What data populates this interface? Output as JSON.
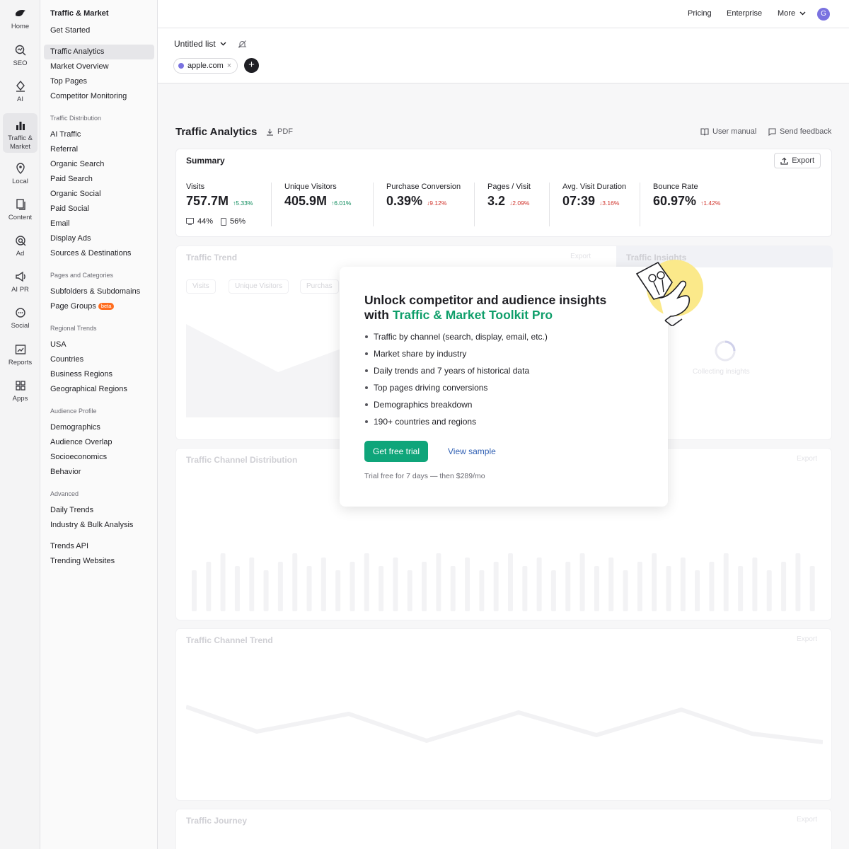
{
  "rail": [
    {
      "label": "Home",
      "icon": "home-icon"
    },
    {
      "label": "SEO",
      "icon": "seo-icon"
    },
    {
      "label": "AI",
      "icon": "ai-icon"
    },
    {
      "label": "Traffic &",
      "label2": "Market",
      "icon": "bar-chart-icon",
      "active": true
    },
    {
      "label": "Local",
      "icon": "map-pin-icon"
    },
    {
      "label": "Content",
      "icon": "content-icon"
    },
    {
      "label": "Ad",
      "icon": "ad-icon"
    },
    {
      "label": "AI PR",
      "icon": "megaphone-icon"
    },
    {
      "label": "Social",
      "icon": "chat-icon"
    },
    {
      "label": "Reports",
      "icon": "reports-icon"
    },
    {
      "label": "Apps",
      "icon": "grid-icon"
    }
  ],
  "nav": {
    "title": "Traffic & Market",
    "get_started": "Get Started",
    "top_items": [
      "Traffic Analytics",
      "Market Overview",
      "Top Pages",
      "Competitor Monitoring"
    ],
    "sections": [
      {
        "title": "Traffic Distribution",
        "items": [
          "AI Traffic",
          "Referral",
          "Organic Search",
          "Paid Search",
          "Organic Social",
          "Paid Social",
          "Email",
          "Display Ads",
          "Sources & Destinations"
        ]
      },
      {
        "title": "Pages and Categories",
        "items": [
          "Subfolders & Subdomains",
          "Page Groups"
        ]
      },
      {
        "title": "Regional Trends",
        "items": [
          "USA",
          "Countries",
          "Business Regions",
          "Geographical Regions"
        ]
      },
      {
        "title": "Audience Profile",
        "items": [
          "Demographics",
          "Audience Overlap",
          "Socioeconomics",
          "Behavior"
        ]
      },
      {
        "title": "Advanced",
        "items": [
          "Daily Trends",
          "Industry & Bulk Analysis"
        ]
      }
    ],
    "beta_badge": "beta",
    "bottom_items": [
      "Trends API",
      "Trending Websites"
    ]
  },
  "topbar": {
    "pricing": "Pricing",
    "enterprise": "Enterprise",
    "more": "More",
    "avatar": "G"
  },
  "subhead": {
    "list_name": "Untitled list",
    "domain": "apple.com",
    "remove": "×",
    "add": "+"
  },
  "page": {
    "title": "Traffic Analytics",
    "pdf": "PDF",
    "user_manual": "User manual",
    "send_feedback": "Send feedback"
  },
  "summary": {
    "title": "Summary",
    "export": "Export",
    "metrics": [
      {
        "label": "Visits",
        "value": "757.7M",
        "delta": "↑5.33%",
        "dir": "up"
      },
      {
        "label": "Unique Visitors",
        "value": "405.9M",
        "delta": "↑6.01%",
        "dir": "up"
      },
      {
        "label": "Purchase Conversion",
        "value": "0.39%",
        "delta": "↓9.12%",
        "dir": "down"
      },
      {
        "label": "Pages / Visit",
        "value": "3.2",
        "delta": "↓2.09%",
        "dir": "down"
      },
      {
        "label": "Avg. Visit Duration",
        "value": "07:39",
        "delta": "↓3.16%",
        "dir": "down"
      },
      {
        "label": "Bounce Rate",
        "value": "60.97%",
        "delta": "↑1.42%",
        "dir": "down"
      }
    ],
    "desktop_share": "44%",
    "mobile_share": "56%"
  },
  "ghost": {
    "trend_title": "Traffic Trend",
    "trend_export": "Export",
    "insights_title": "Traffic Insights",
    "collecting": "Collecting insights",
    "pills": [
      "Visits",
      "Unique Visitors",
      "Purchas"
    ],
    "channel_dist_title": "Traffic Channel Distribution",
    "channel_trend_title": "Traffic Channel Trend",
    "journey_title": "Traffic Journey",
    "export": "Export"
  },
  "modal": {
    "heading_line1": "Unlock competitor and audience insights",
    "heading_with": "with ",
    "heading_accent": "Traffic & Market Toolkit Pro",
    "bullets": [
      "Traffic by channel (search, display, email, etc.)",
      "Market share by industry",
      "Daily trends and 7 years of historical data",
      "Top pages driving conversions",
      "Demographics breakdown",
      "190+ countries and regions"
    ],
    "cta": "Get free trial",
    "sample": "View sample",
    "trial_note": "Trial free for 7 days — then $289/mo"
  },
  "colors": {
    "accent_green": "#0fa57a",
    "link_blue": "#2f5fb3",
    "up": "#0a8a5a",
    "down": "#d0332b",
    "avatar": "#7a72e0"
  }
}
